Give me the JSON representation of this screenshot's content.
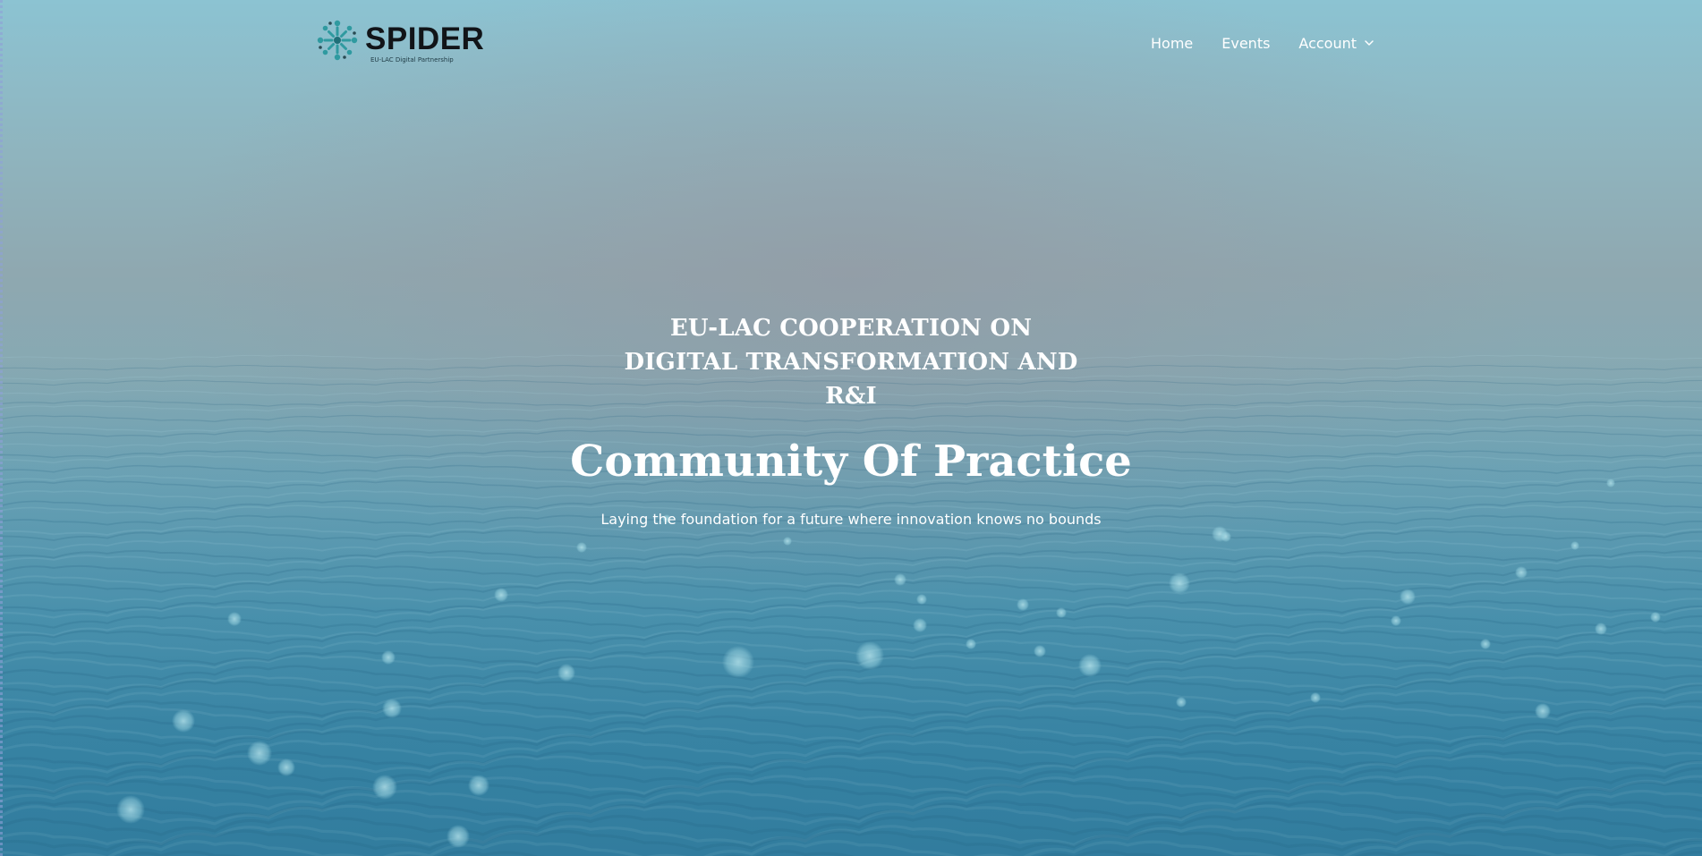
{
  "brand": {
    "name": "SPIDER",
    "tagline": "EU-LAC Digital Partnership",
    "logo_icon": "spider-network-logo",
    "accent_color": "#2f9aa0"
  },
  "nav": {
    "items": [
      {
        "label": "Home"
      },
      {
        "label": "Events"
      },
      {
        "label": "Account",
        "icon": "chevron-down-icon"
      }
    ]
  },
  "hero": {
    "kicker": "EU-LAC COOPERATION ON DIGITAL TRANSFORMATION AND R&I",
    "title": "Community Of Practice",
    "subtitle": "Laying the foundation for a future where innovation knows no bounds"
  },
  "theme": {
    "text_color": "#ffffff",
    "sea_color": "#3a89aa",
    "mist_color": "#8fa8b0"
  }
}
